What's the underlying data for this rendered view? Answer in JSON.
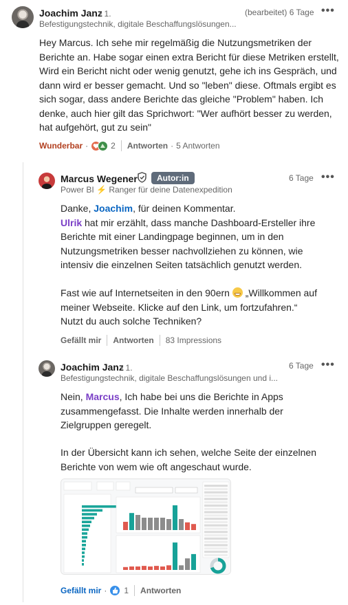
{
  "comment1": {
    "author": "Joachim Janz",
    "degree": "• 1.",
    "headline": "Befestigungstechnik, digitale Beschaffungslösungen...",
    "time": "(bearbeitet) 6 Tage",
    "more": "•••",
    "text": "Hey Marcus. Ich sehe mir regelmäßig die Nutzungsmetriken der Berichte an. Habe sogar einen extra Bericht für diese Metriken erstellt, Wird ein Bericht nicht oder wenig genutzt, gehe ich ins Gespräch, und dann wird er besser gemacht. Und so \"leben\" diese. Oftmals ergibt es sich sogar, dass andere Berichte das gleiche \"Problem\" haben. Ich denke, auch hier gilt das Sprichwort: \"Wer aufhört besser zu werden, hat aufgehört, gut zu sein\"",
    "reaction_label": "Wunderbar",
    "reaction_color": "#b24020",
    "reaction_count": "2",
    "reply_label": "Antworten",
    "replies_count": "5 Antworten"
  },
  "reply1": {
    "author": "Marcus Wegener",
    "badge": "Autor:in",
    "headline_prefix": "Power BI",
    "headline_rest": "Ranger für deine Datenexpedition",
    "time": "6 Tage",
    "more": "•••",
    "line1_pre": "Danke, ",
    "line1_mention": "Joachim",
    "line1_post": ", für deinen Kommentar.",
    "line2_mention": "Ulrik",
    "line2_post": " hat mir erzählt, dass manche Dashboard-Ersteller ihre Berichte mit einer Landingpage beginnen, um in den Nutzungsmetriken besser nachvollziehen zu können, wie intensiv die einzelnen Seiten tatsächlich genutzt werden.",
    "para2_pre": "Fast wie auf Internetseiten in den 90ern ",
    "para2_post": " „Willkommen auf meiner Webseite. Klicke auf den Link, um fortzufahren.“",
    "para2_line3": "Nutzt du auch solche Techniken?",
    "like_label": "Gefällt mir",
    "reply_label": "Antworten",
    "impressions": "83 Impressions"
  },
  "reply2": {
    "author": "Joachim Janz",
    "degree": "• 1.",
    "headline": "Befestigungstechnik, digitale Beschaffungslösungen und i...",
    "time": "6 Tage",
    "more": "•••",
    "p1_pre": "Nein, ",
    "p1_mention": "Marcus",
    "p1_post": ", Ich habe bei uns die Berichte in Apps zusammengefasst. Die Inhalte werden innerhalb der Zielgruppen geregelt.",
    "p2": "In der Übersicht kann ich sehen, welche Seite der einzelnen Berichte von wem wie oft angeschaut wurde.",
    "like_label": "Gefällt mir",
    "like_count": "1",
    "reply_label": "Antworten"
  },
  "colors": {
    "mention_blue": "#0a66c2",
    "mention_purple": "#7a3fc6",
    "badge_bg": "#5f6b7a"
  },
  "dashboard_chart": {
    "top_values": [
      30,
      62,
      55,
      45,
      45,
      45,
      45,
      40,
      90,
      40,
      28,
      22
    ],
    "bottom_values": [
      10,
      12,
      12,
      14,
      12,
      14,
      12,
      16,
      95,
      16,
      40,
      55
    ],
    "donut_fraction": 0.7
  }
}
